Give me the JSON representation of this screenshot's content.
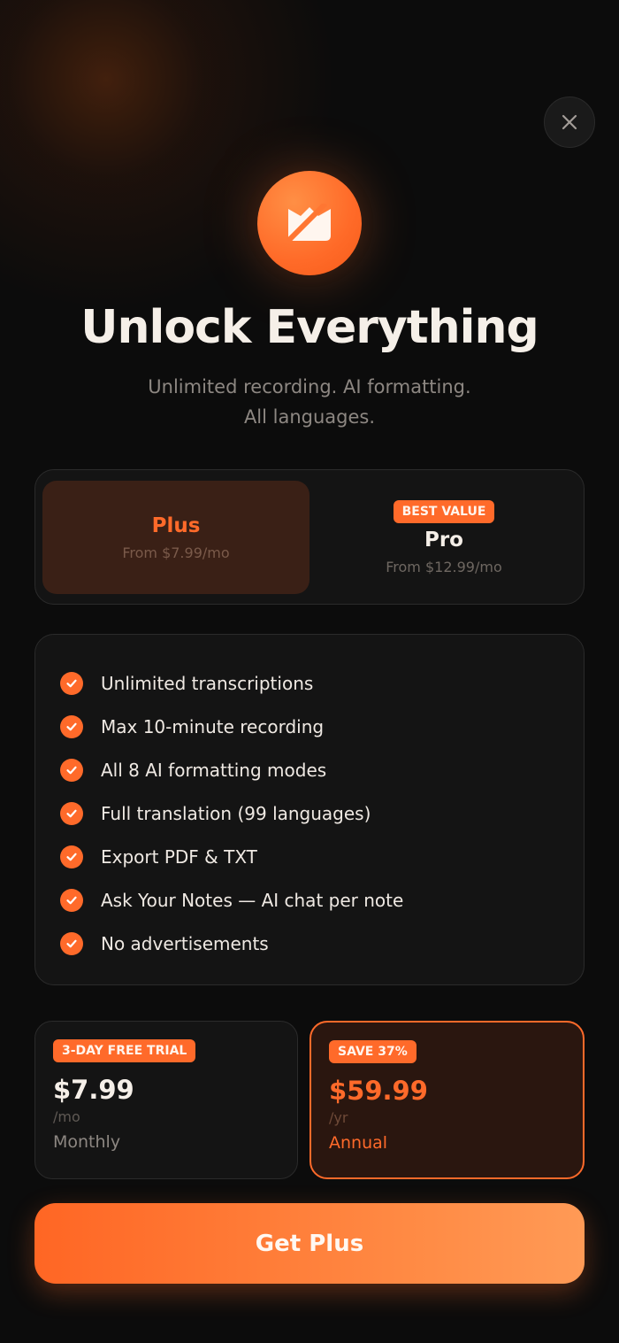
{
  "header": {
    "close_icon": "close-icon",
    "logo_icon": "app-logo-icon",
    "title": "Unlock Everything",
    "subtitle_line1": "Unlimited recording. AI formatting.",
    "subtitle_line2": "All languages."
  },
  "plans": [
    {
      "name": "Plus",
      "price": "From $7.99/mo",
      "selected": true
    },
    {
      "name": "Pro",
      "price": "From $12.99/mo",
      "badge": "BEST VALUE",
      "selected": false
    }
  ],
  "features": [
    "Unlimited transcriptions",
    "Max 10-minute recording",
    "All 8 AI formatting modes",
    "Full translation (99 languages)",
    "Export PDF & TXT",
    "Ask Your Notes — AI chat per note",
    "No advertisements"
  ],
  "billing": {
    "monthly": {
      "badge": "3-DAY FREE TRIAL",
      "amount": "$7.99",
      "unit": "/mo",
      "label": "Monthly",
      "selected": false
    },
    "annual": {
      "badge": "SAVE 37%",
      "amount": "$59.99",
      "unit": "/yr",
      "label": "Annual",
      "selected": true
    }
  },
  "cta": {
    "label": "Get Plus"
  },
  "colors": {
    "accent": "#ff6a2a",
    "background": "#0c0c0c",
    "card": "#141414"
  }
}
